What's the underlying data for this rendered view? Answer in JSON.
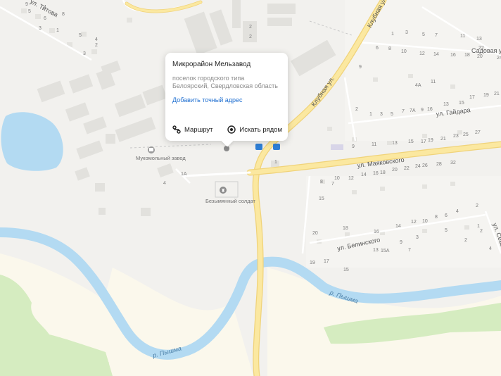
{
  "popup": {
    "title": "Микрорайон Мельзавод",
    "subtitle": "поселок городского типа Белоярский, Свердловская область",
    "add_address_link": "Добавить точный адрес",
    "route_label": "Маршрут",
    "search_nearby_label": "Искать рядом"
  },
  "map": {
    "streets": {
      "klubnaya": "Клубная ул.",
      "mayakovskogo": "ул. Маяковского",
      "gaydara": "ул. Гайдара",
      "sadovaya": "Садовая ул.",
      "belinskogo": "ул. Белинского",
      "sevastopolskaya": "ул. Севастопольская",
      "tipova": "ул. Титова"
    },
    "rivers": {
      "pyshma_east": "р. Пышма",
      "pyshma_south": "р. Пышма"
    },
    "pois": {
      "mill": "Мукомольный завод",
      "soldier": "Безымянный солдат"
    },
    "house_numbers": {
      "northwest": [
        "9",
        "4",
        "5",
        "8",
        "6",
        "3",
        "1",
        "5",
        "4",
        "3",
        "2"
      ],
      "north_center": [
        "2",
        "2"
      ],
      "northeast": [
        "1",
        "3",
        "5",
        "7",
        "11",
        "13",
        "6",
        "8",
        "10",
        "12",
        "14",
        "16",
        "18",
        "20",
        "22",
        "24",
        "9",
        "4А",
        "11",
        "13",
        "15",
        "17",
        "19",
        "21"
      ],
      "gaydara": [
        "2",
        "1",
        "3",
        "5",
        "7",
        "7А",
        "9",
        "16"
      ],
      "between_gaydara_mayakovskogo": [
        "9",
        "11",
        "13",
        "15",
        "17",
        "19",
        "21",
        "23",
        "25",
        "27"
      ],
      "mayakovskogo_south": [
        "10",
        "12",
        "14",
        "16",
        "18",
        "20",
        "22",
        "24",
        "26",
        "28",
        "32"
      ],
      "misc": [
        "1А",
        "4",
        "8",
        "7",
        "15",
        "1"
      ],
      "south_block": [
        "20",
        "18",
        "16",
        "14",
        "12",
        "10",
        "8",
        "6",
        "4",
        "2",
        "2",
        "5",
        "3",
        "9",
        "7",
        "13",
        "15А",
        "17",
        "19",
        "15",
        "1",
        "4",
        "2"
      ]
    }
  },
  "colors": {
    "background": "#f2f1ee",
    "water": "#b3daf2",
    "road_major": "#fbe8a0",
    "road_major_edge": "#f0d37a",
    "forest": "#d5ecc0",
    "link": "#1f6fd1",
    "building": "#dfdeda"
  },
  "icons": {
    "route": "route-icon",
    "search": "search-nearby-icon",
    "bus_stop": "bus-stop-icon",
    "factory": "factory-icon",
    "monument": "monument-icon"
  }
}
